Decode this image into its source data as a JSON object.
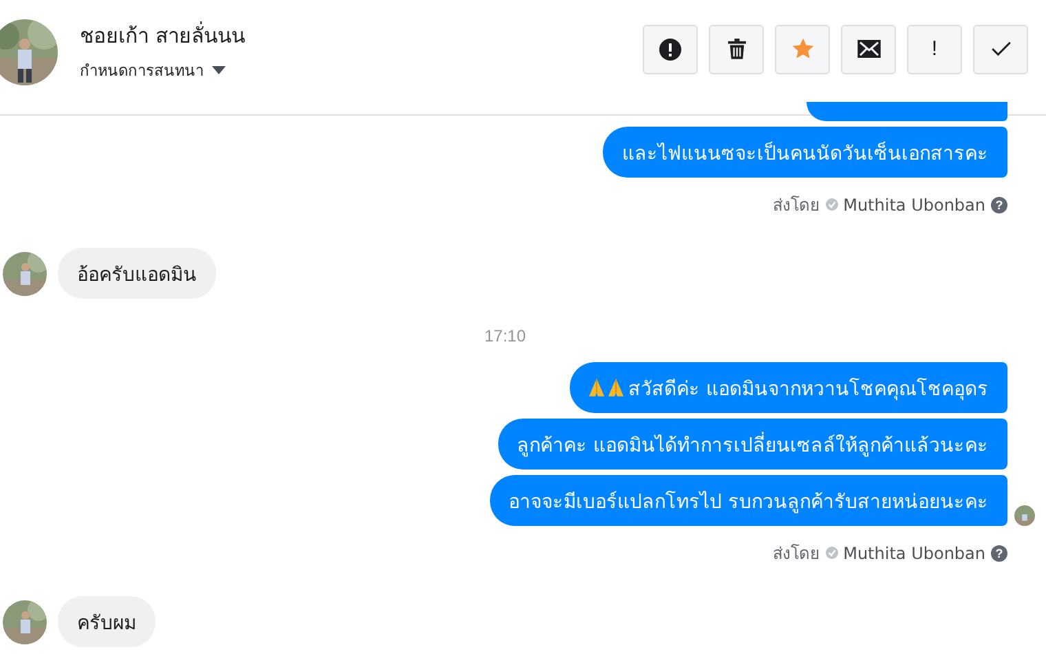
{
  "header": {
    "name": "ชอยเก้า สายลั่นนน",
    "subtitle": "กำหนดการสนทนา",
    "buttons": [
      {
        "kind": "alert"
      },
      {
        "kind": "trash"
      },
      {
        "kind": "star"
      },
      {
        "kind": "mail"
      },
      {
        "kind": "exclaim",
        "label": "!"
      },
      {
        "kind": "check"
      }
    ]
  },
  "thread": [
    {
      "kind": "outgoing",
      "cut_top": true,
      "messages": [
        {
          "kind": "plain",
          "text": "และไฟแนนซจะเป็นคนนัดวันเซ็นเอกสารคะ"
        }
      ],
      "sent_by": {
        "prefix": "ส่งโดย",
        "name": "Muthita Ubonban",
        "help": "?"
      },
      "seen": false
    },
    {
      "kind": "incoming",
      "messages": [
        {
          "text": "อ้อครับแอดมิน"
        }
      ]
    },
    {
      "kind": "time",
      "text": "17:10"
    },
    {
      "kind": "outgoing",
      "cut_top": false,
      "messages": [
        {
          "kind": "with_icons",
          "text": "สวัสดีค่ะ แอดมินจากหวานโชคคุณโชคอุดร"
        },
        {
          "kind": "plain",
          "text": "ลูกค้าคะ แอดมินได้ทำการเปลี่ยนเซลล์ให้ลูกค้าแล้วนะคะ"
        },
        {
          "kind": "plain",
          "text": "อาจจะมีเบอร์แปลกโทรไป รบกวนลูกค้ารับสายหน่อยนะคะ"
        }
      ],
      "sent_by": {
        "prefix": "ส่งโดย",
        "name": "Muthita Ubonban",
        "help": "?"
      },
      "seen": true
    },
    {
      "kind": "incoming",
      "messages": [
        {
          "text": "ครับผม"
        }
      ]
    }
  ]
}
